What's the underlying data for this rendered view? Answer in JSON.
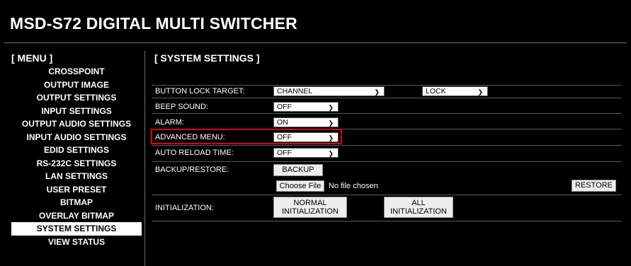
{
  "header": {
    "title": "MSD-S72 DIGITAL MULTI SWITCHER"
  },
  "sidebar": {
    "title": "[ MENU ]",
    "items": [
      {
        "label": "CROSSPOINT"
      },
      {
        "label": "OUTPUT IMAGE"
      },
      {
        "label": "OUTPUT SETTINGS"
      },
      {
        "label": "INPUT SETTINGS"
      },
      {
        "label": "OUTPUT AUDIO SETTINGS"
      },
      {
        "label": "INPUT AUDIO SETTINGS"
      },
      {
        "label": "EDID SETTINGS"
      },
      {
        "label": "RS-232C SETTINGS"
      },
      {
        "label": "LAN SETTINGS"
      },
      {
        "label": "USER PRESET"
      },
      {
        "label": "BITMAP"
      },
      {
        "label": "OVERLAY BITMAP"
      },
      {
        "label": "SYSTEM SETTINGS",
        "active": true
      },
      {
        "label": "VIEW STATUS"
      }
    ]
  },
  "main": {
    "title": "[ SYSTEM SETTINGS ]",
    "button_lock_target": {
      "label": "BUTTON LOCK TARGET:",
      "target_value": "CHANNEL",
      "lock_value": "LOCK"
    },
    "beep_sound": {
      "label": "BEEP SOUND:",
      "value": "OFF"
    },
    "alarm": {
      "label": "ALARM:",
      "value": "ON"
    },
    "advanced_menu": {
      "label": "ADVANCED MENU:",
      "value": "OFF"
    },
    "auto_reload_time": {
      "label": "AUTO RELOAD TIME:",
      "value": "OFF"
    },
    "backup_restore": {
      "label": "BACKUP/RESTORE:",
      "backup_button": "BACKUP",
      "choose_file_button": "Choose File",
      "file_status": "No file chosen",
      "restore_button": "RESTORE"
    },
    "initialization": {
      "label": "INITIALIZATION:",
      "normal_line1": "NORMAL",
      "normal_line2": "INITIALIZATION",
      "all_line1": "ALL",
      "all_line2": "INITIALIZATION"
    }
  },
  "colors": {
    "background": "#000000",
    "highlight_border": "#d9001b",
    "active_menu_bg": "#ffffff"
  },
  "icons": {
    "select_caret": "chevron-down-icon"
  }
}
